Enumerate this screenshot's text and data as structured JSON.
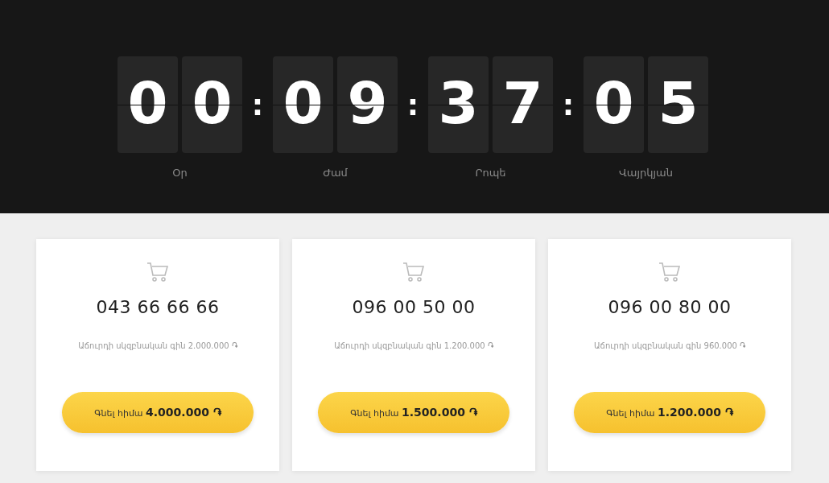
{
  "countdown": [
    {
      "digits": [
        "0",
        "0"
      ],
      "label": "Օր"
    },
    {
      "digits": [
        "0",
        "9"
      ],
      "label": "Ժամ"
    },
    {
      "digits": [
        "3",
        "7"
      ],
      "label": "Րոպե"
    },
    {
      "digits": [
        "0",
        "5"
      ],
      "label": "Վայրկյան"
    }
  ],
  "separator": ":",
  "offers": [
    {
      "phone": "043 66 66 66",
      "start_price": "Աճուրդի սկզբնական գին  2.000.000 ֏",
      "button": "Գնել հիմա **4.000.000 ֏**"
    },
    {
      "phone": "096 00 50 00",
      "start_price": "Աճուրդի սկզբնական գին  1.200.000 ֏",
      "button": "Գնել հիմա **1.500.000 ֏**"
    },
    {
      "phone": "096 00 80 00",
      "start_price": "Աճուրդի սկզբնական գին  960.000 ֏",
      "button": "Գնել հիմա **1.200.000 ֏**"
    }
  ]
}
